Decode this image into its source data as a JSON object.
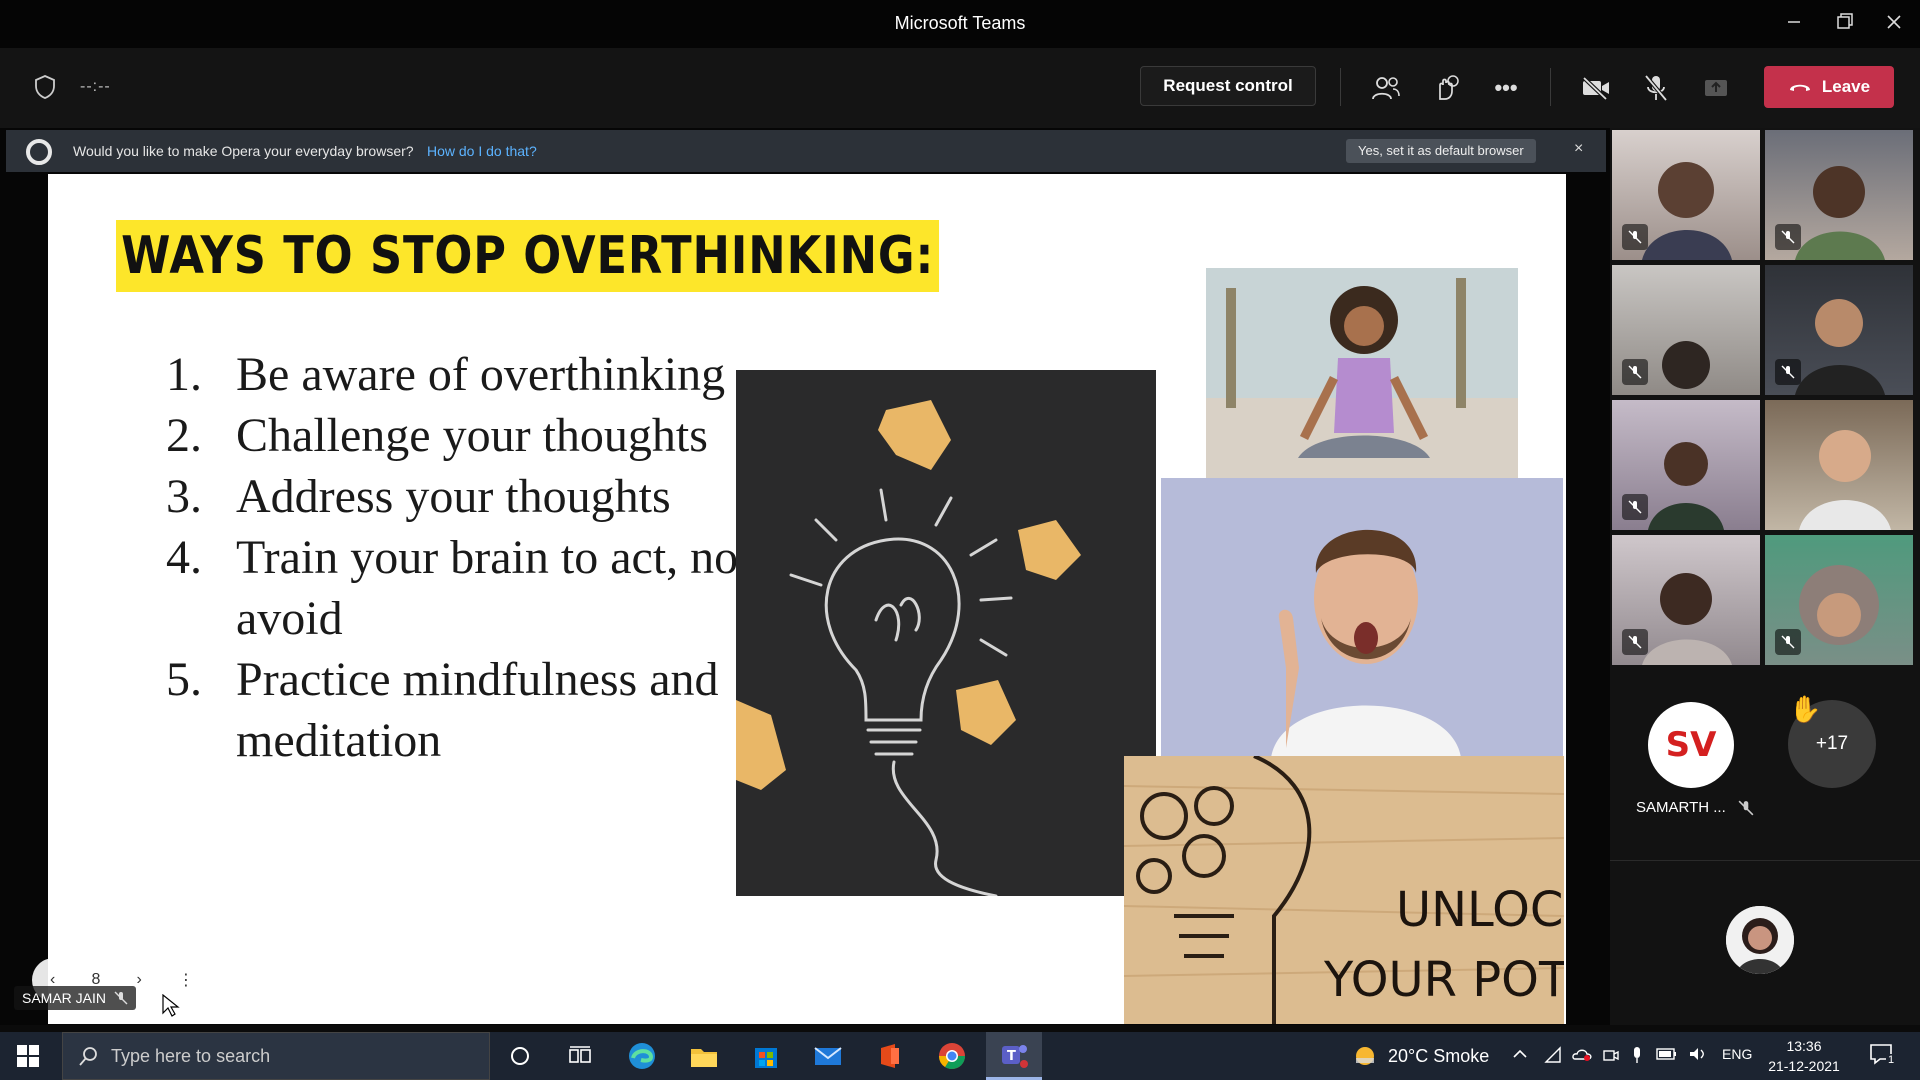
{
  "window": {
    "title": "Microsoft Teams",
    "controls": [
      "minimize-icon",
      "restore-icon",
      "close-icon"
    ]
  },
  "toolbar": {
    "timer": "--:--",
    "request_control": "Request control",
    "more": "•••",
    "leave": "Leave",
    "colors": {
      "leave": "#c4314b"
    }
  },
  "opera": {
    "question": "Would you like to make Opera your everyday browser?",
    "link": "How do I do that?",
    "accept": "Yes, set it as default browser",
    "close": "×"
  },
  "slide": {
    "title": "WAYS TO STOP OVERTHINKING:",
    "items": [
      {
        "num": "1.",
        "lines": [
          "Be aware of overthinking"
        ]
      },
      {
        "num": "2.",
        "lines": [
          "Challenge your thoughts"
        ]
      },
      {
        "num": "3.",
        "lines": [
          "Address your thoughts"
        ]
      },
      {
        "num": "4.",
        "lines": [
          "Train your brain to act, not",
          "avoid"
        ]
      },
      {
        "num": "5.",
        "lines": [
          "Practice mindfulness and",
          "meditation"
        ]
      }
    ],
    "wood_text_1": "UNLOCK",
    "wood_text_2": "YOUR POTEN"
  },
  "slide_nav": {
    "page": "8",
    "prev": "‹",
    "next": "›",
    "more": "⋮"
  },
  "presenter_chip": {
    "name": "SAMAR JAIN"
  },
  "participants": {
    "video_tiles": 8,
    "samarth": {
      "initials": "SV",
      "name": "SAMARTH ..."
    },
    "more_count": "+17",
    "hand": "✋"
  },
  "taskbar": {
    "search_placeholder": "Type here to search",
    "weather": "20°C  Smoke",
    "language": "ENG",
    "time": "13:36",
    "date": "21-12-2021",
    "notifications": "1"
  }
}
